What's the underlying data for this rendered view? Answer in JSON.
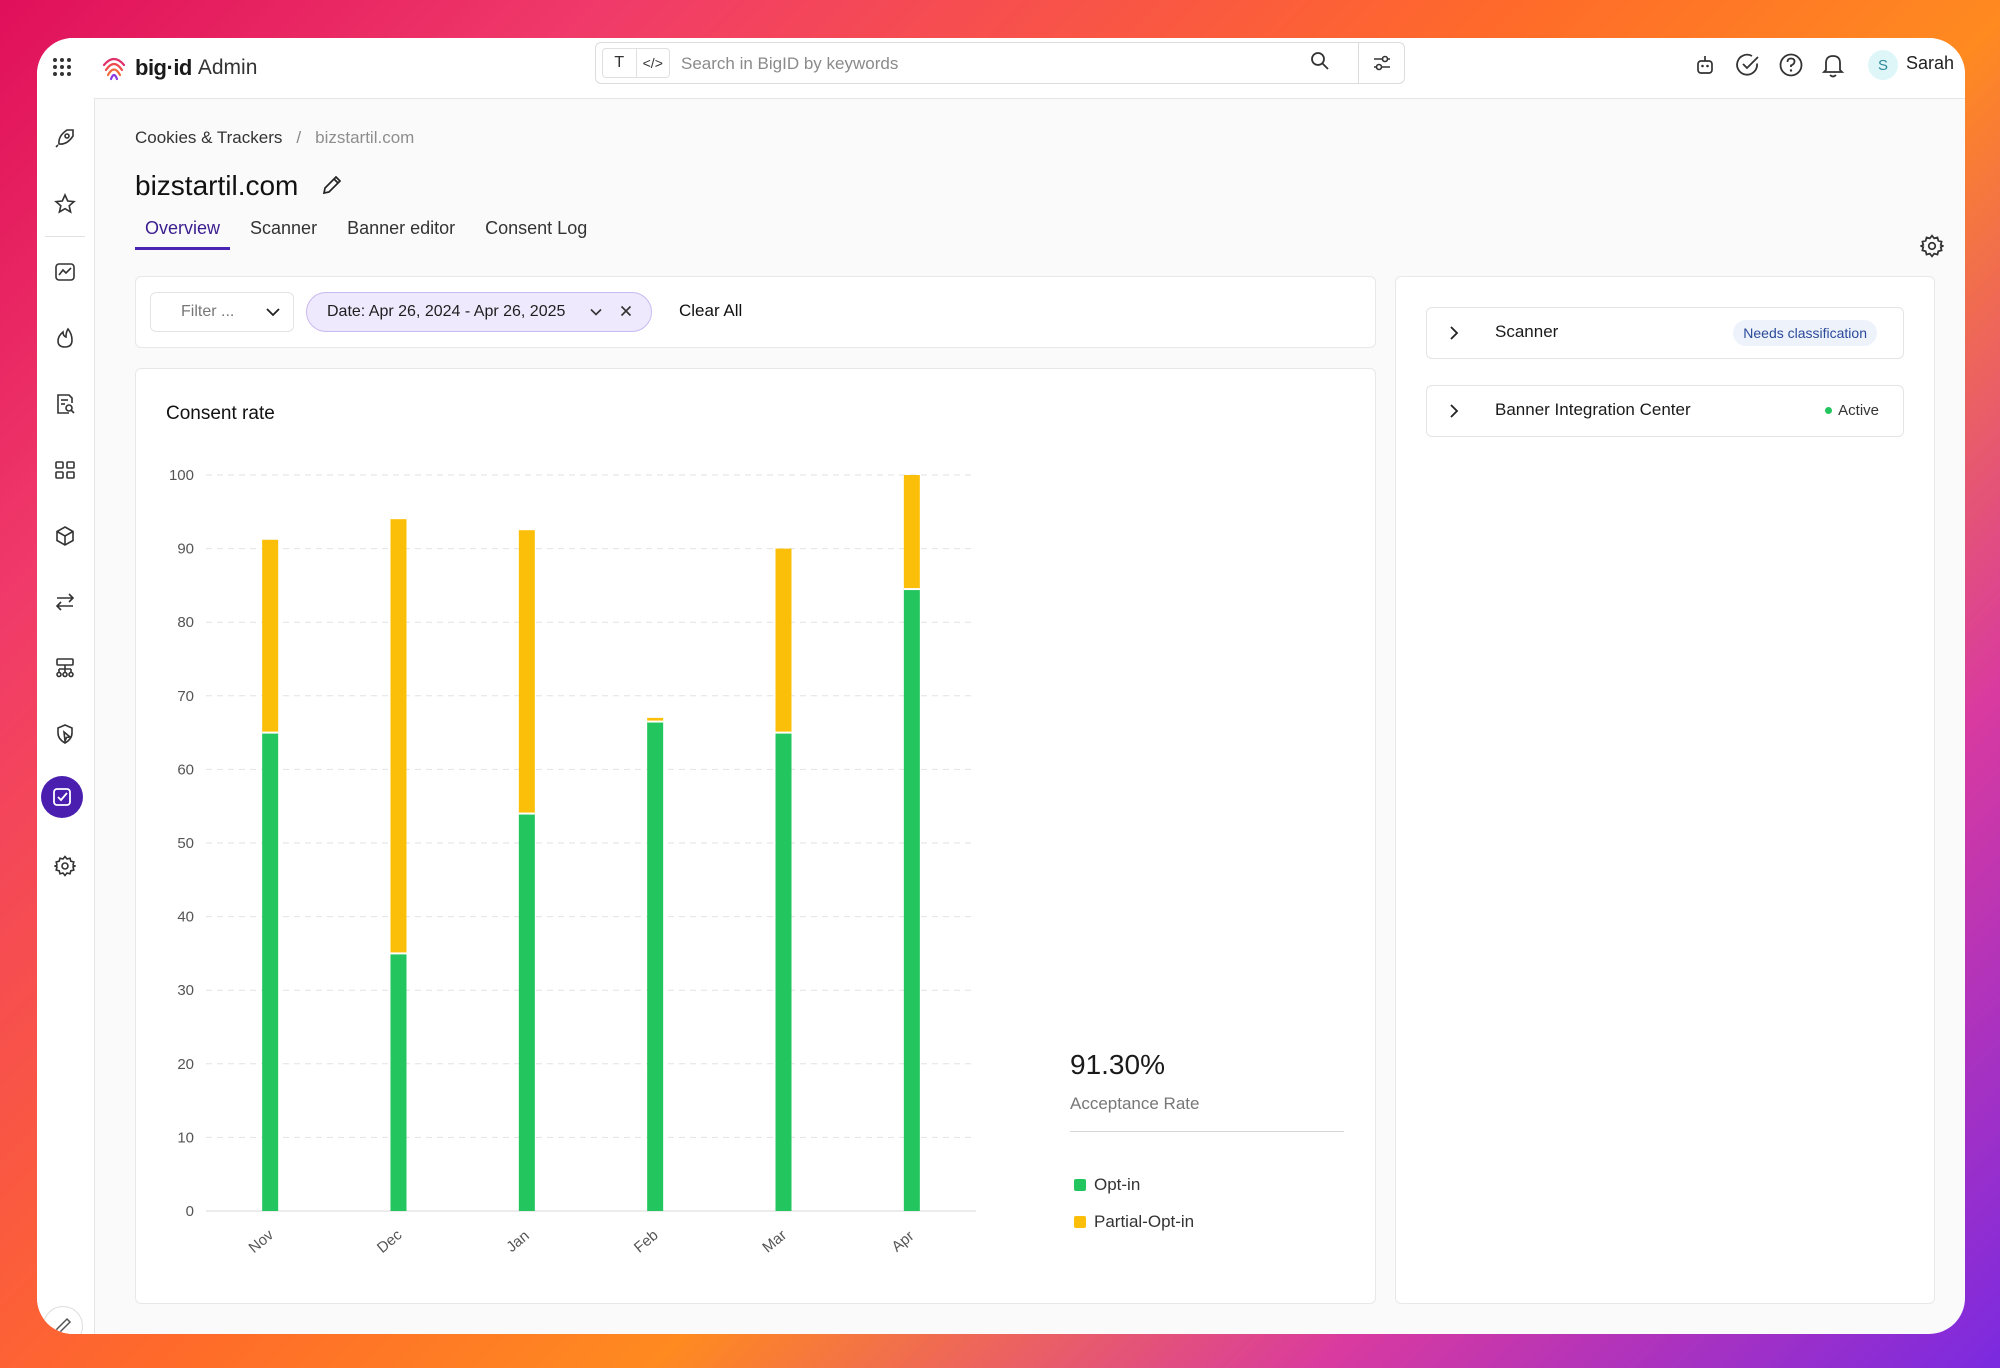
{
  "app": {
    "logo": "big·id",
    "title": "Admin"
  },
  "search": {
    "placeholder": "Search in BigID by keywords",
    "mode_text": "T",
    "mode_code": "</>"
  },
  "user": {
    "initial": "S",
    "name": "Sarah"
  },
  "breadcrumb": {
    "parent": "Cookies & Trackers",
    "separator": "/",
    "current": "bizstartil.com"
  },
  "page": {
    "title": "bizstartil.com"
  },
  "tabs": [
    {
      "label": "Overview",
      "active": true
    },
    {
      "label": "Scanner",
      "active": false
    },
    {
      "label": "Banner editor",
      "active": false
    },
    {
      "label": "Consent Log",
      "active": false
    }
  ],
  "filters": {
    "filter_placeholder": "Filter ...",
    "date_chip": "Date: Apr 26, 2024 - Apr 26, 2025",
    "clear_all": "Clear All"
  },
  "chart_data": {
    "type": "bar",
    "stacked": true,
    "title": "Consent rate",
    "categories": [
      "Nov",
      "Dec",
      "Jan",
      "Feb",
      "Mar",
      "Apr"
    ],
    "series": [
      {
        "name": "Opt-in",
        "color": "#22c55e",
        "values": [
          65,
          35,
          54,
          66.5,
          65,
          84.5
        ]
      },
      {
        "name": "Partial-Opt-in",
        "color": "#fbbf0a",
        "values": [
          26.2,
          59,
          38.5,
          0.5,
          25,
          15.5
        ]
      }
    ],
    "ylim": [
      0,
      100
    ],
    "yticks": [
      0,
      10,
      20,
      30,
      40,
      50,
      60,
      70,
      80,
      90,
      100
    ],
    "grid": true,
    "legend": "right"
  },
  "kpi": {
    "value": "91.30%",
    "label": "Acceptance Rate"
  },
  "right_panel": {
    "items": [
      {
        "label": "Scanner",
        "badge": "Needs classification"
      },
      {
        "label": "Banner Integration Center",
        "status": "Active"
      }
    ]
  },
  "colors": {
    "accent": "#4a25b5",
    "opt_in": "#22c55e",
    "partial": "#fbbf0a"
  }
}
